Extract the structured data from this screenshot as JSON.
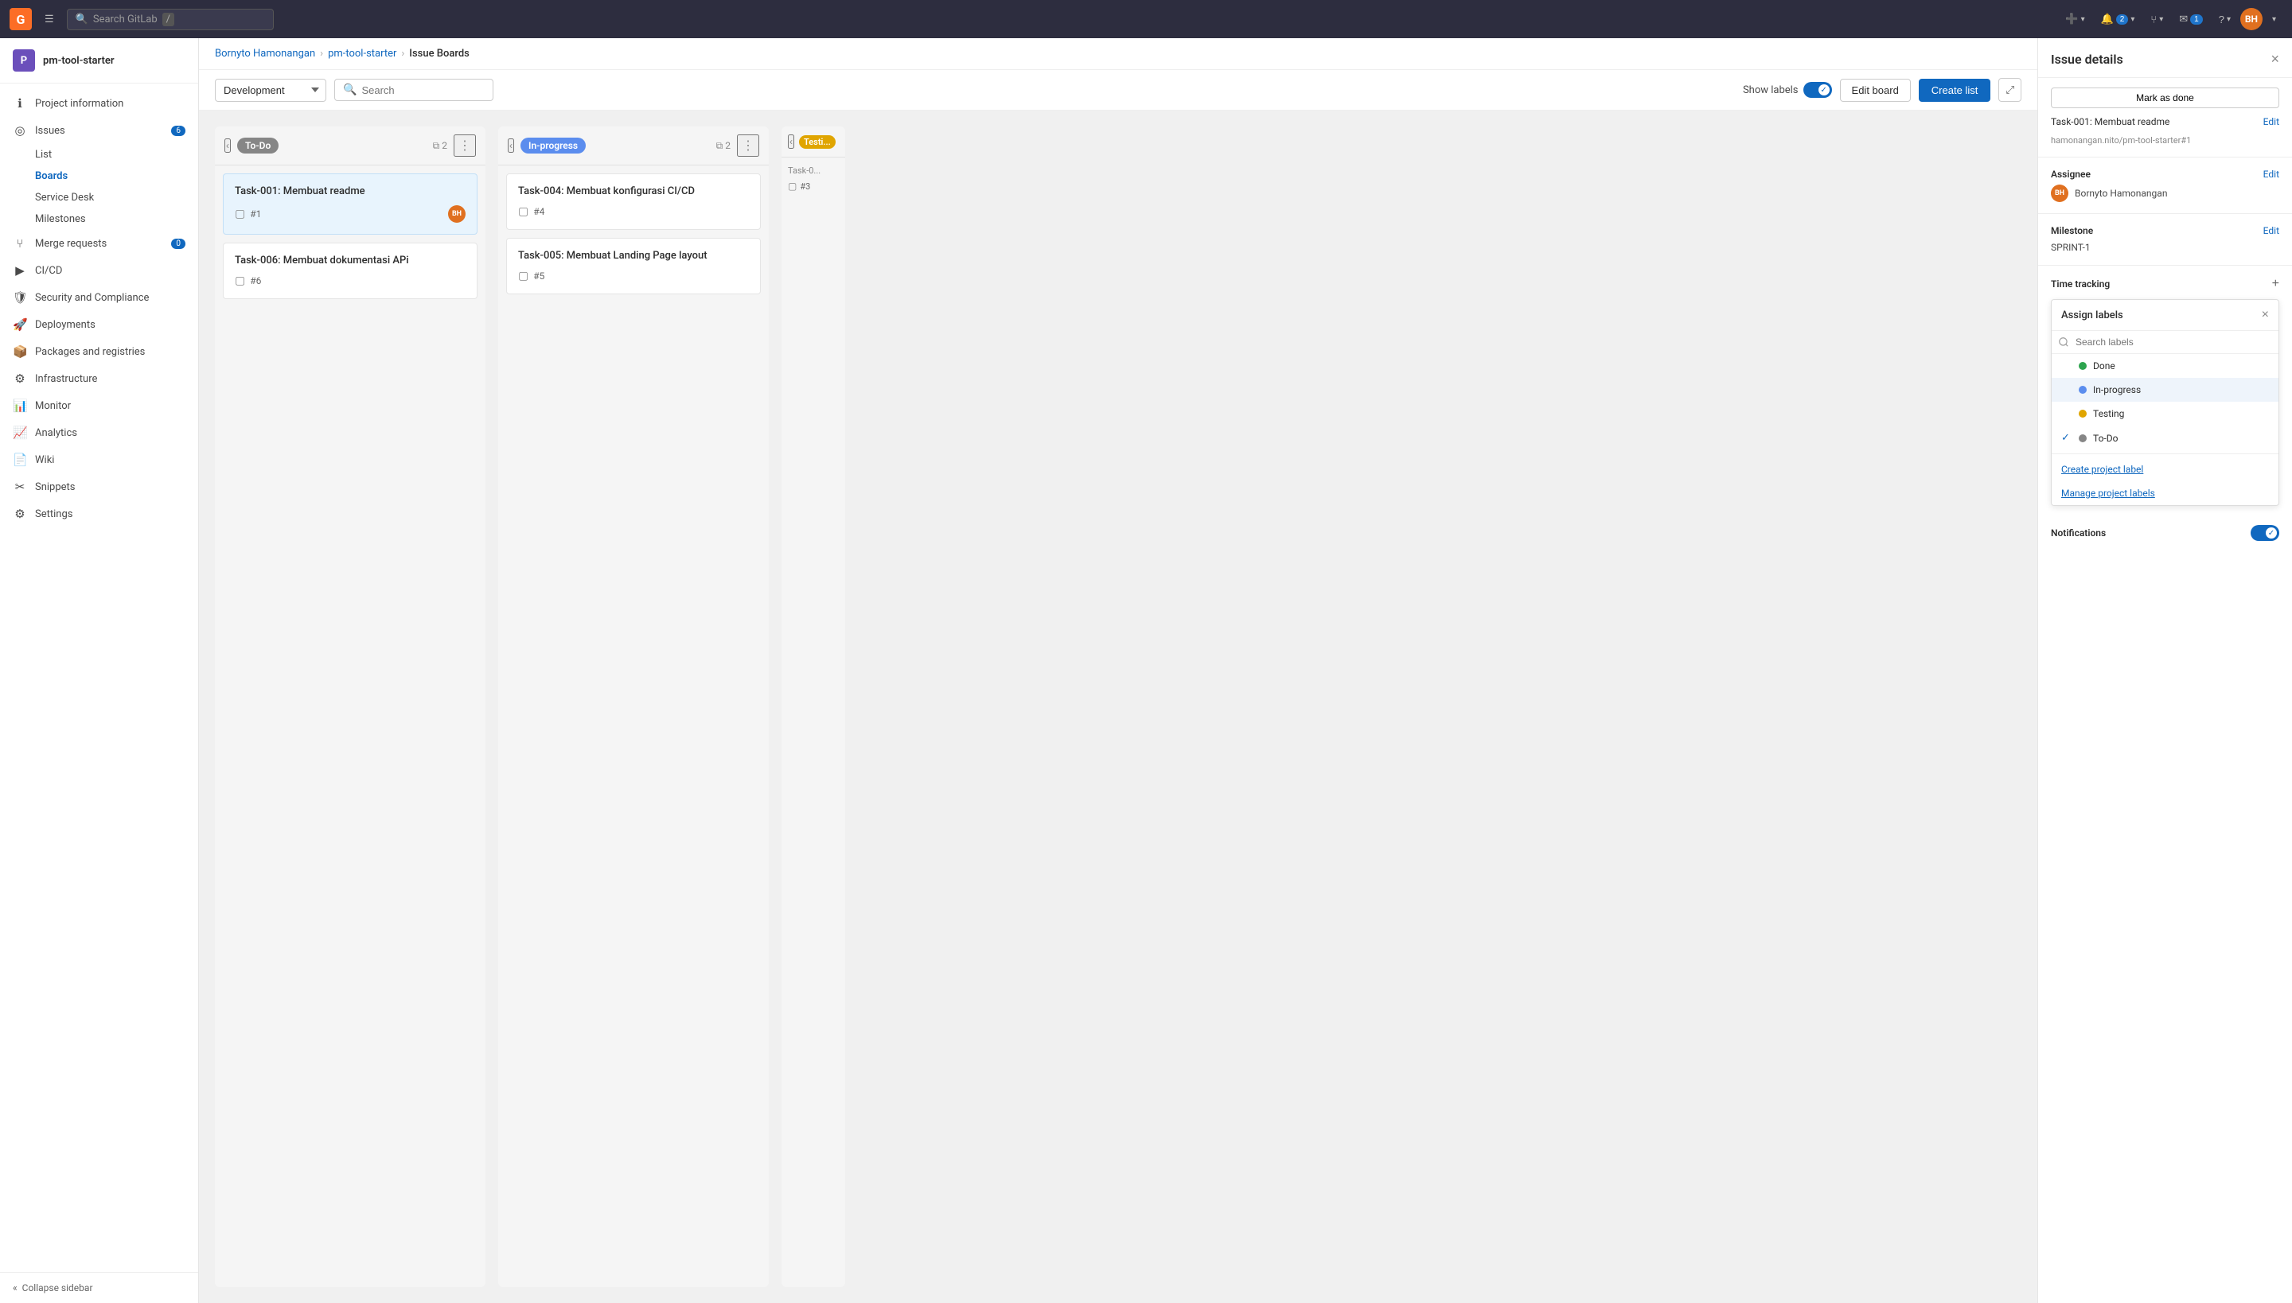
{
  "topnav": {
    "logo": "G",
    "hamburger": "☰",
    "search_placeholder": "Search GitLab",
    "slash_key": "/",
    "buttons": [
      {
        "label": "+",
        "badge": null
      },
      {
        "label": "🔔",
        "badge": "2"
      },
      {
        "label": "⑂",
        "badge": null
      },
      {
        "label": "✉",
        "badge": "1"
      },
      {
        "label": "?",
        "badge": null
      }
    ],
    "avatar_initials": "BH"
  },
  "sidebar": {
    "project_icon": "P",
    "project_name": "pm-tool-starter",
    "items": [
      {
        "id": "project-information",
        "icon": "ℹ",
        "label": "Project information",
        "badge": null
      },
      {
        "id": "issues",
        "icon": "◎",
        "label": "Issues",
        "badge": "6"
      },
      {
        "id": "boards",
        "icon": "⊞",
        "label": "Boards",
        "active": true
      },
      {
        "id": "service-desk",
        "icon": "✉",
        "label": "Service Desk"
      },
      {
        "id": "milestones",
        "icon": "◎",
        "label": "Milestones"
      },
      {
        "id": "merge-requests",
        "icon": "⑂",
        "label": "Merge requests",
        "badge": "0"
      },
      {
        "id": "ci-cd",
        "icon": "▶",
        "label": "CI/CD"
      },
      {
        "id": "security",
        "icon": "🛡",
        "label": "Security and Compliance"
      },
      {
        "id": "deployments",
        "icon": "🚀",
        "label": "Deployments"
      },
      {
        "id": "packages",
        "icon": "📦",
        "label": "Packages and registries"
      },
      {
        "id": "infrastructure",
        "icon": "⚙",
        "label": "Infrastructure"
      },
      {
        "id": "monitor",
        "icon": "📊",
        "label": "Monitor"
      },
      {
        "id": "analytics",
        "icon": "📈",
        "label": "Analytics"
      },
      {
        "id": "wiki",
        "icon": "📄",
        "label": "Wiki"
      },
      {
        "id": "snippets",
        "icon": "✂",
        "label": "Snippets"
      },
      {
        "id": "settings",
        "icon": "⚙",
        "label": "Settings"
      }
    ],
    "collapse_label": "Collapse sidebar"
  },
  "breadcrumb": {
    "items": [
      "Bornyto Hamonangan",
      "pm-tool-starter",
      "Issue Boards"
    ]
  },
  "toolbar": {
    "board_options": [
      "Development"
    ],
    "board_selected": "Development",
    "search_placeholder": "Search",
    "show_labels": "Show labels",
    "edit_board": "Edit board",
    "create_list": "Create list"
  },
  "columns": [
    {
      "id": "todo",
      "label": "To-Do",
      "label_class": "label-todo",
      "count": 2,
      "cards": [
        {
          "title": "Task-001: Membuat readme",
          "issue_num": "#1",
          "highlighted": true,
          "has_avatar": true,
          "avatar_initials": "BH"
        },
        {
          "title": "Task-006: Membuat dokumentasi APi",
          "issue_num": "#6",
          "highlighted": false,
          "has_avatar": false
        }
      ]
    },
    {
      "id": "inprogress",
      "label": "In-progress",
      "label_class": "label-inprogress",
      "count": 2,
      "cards": [
        {
          "title": "Task-004: Membuat konfigurasi CI/CD",
          "issue_num": "#4",
          "highlighted": false,
          "has_avatar": false
        },
        {
          "title": "Task-005: Membuat Landing Page layout",
          "issue_num": "#5",
          "highlighted": false,
          "has_avatar": false
        }
      ]
    }
  ],
  "partial_column": {
    "label": "Testi...",
    "issue_num": "#3",
    "task_title": "Task-0..."
  },
  "issue_details": {
    "panel_title": "Issue details",
    "close_btn": "×",
    "mark_done_label": "Mark as done",
    "task_title": "Task-001: Membuat readme",
    "edit_label": "Edit",
    "task_link": "hamonangan.nito/pm-tool-starter#1",
    "assignee_label": "Assignee",
    "assignee_edit": "Edit",
    "assignee_name": "Bornyto Hamonangan",
    "assignee_initials": "BH",
    "milestone_label": "Milestone",
    "milestone_edit": "Edit",
    "milestone_value": "SPRINT-1",
    "time_tracking_label": "Time tracking",
    "time_tracking_add": "+",
    "labels_dropdown": {
      "title": "Assign labels",
      "close_btn": "×",
      "search_placeholder": "Search labels",
      "labels": [
        {
          "name": "Done",
          "color": "#2da44e",
          "selected": false
        },
        {
          "name": "In-progress",
          "color": "#5b8dee",
          "selected": true
        },
        {
          "name": "Testing",
          "color": "#e0a500",
          "selected": false
        },
        {
          "name": "To-Do",
          "color": "#868686",
          "selected": false,
          "checked": true
        }
      ],
      "create_label": "Create project label",
      "manage_label": "Manage project labels"
    },
    "notifications_label": "Notifications",
    "notifications_on": true
  }
}
